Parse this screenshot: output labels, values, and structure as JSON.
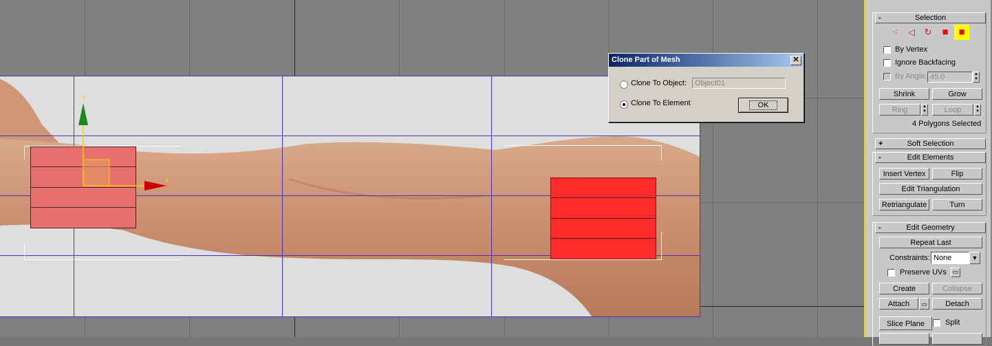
{
  "dialog": {
    "title": "Clone Part of Mesh",
    "close_glyph": "✕",
    "clone_to_object_label": "Clone To Object:",
    "clone_to_object_value": "Object01",
    "clone_to_element_label": "Clone To Element",
    "selected_option": "Clone To Element",
    "ok_label": "OK"
  },
  "gizmo": {
    "x_axis_label": "x",
    "y_axis_label": "y"
  },
  "panel": {
    "selection": {
      "header": "Selection",
      "header_sign": "-",
      "subobject_icons": [
        "vertex-icon",
        "edge-icon",
        "border-icon",
        "polygon-icon",
        "element-icon"
      ],
      "by_vertex_label": "By Vertex",
      "ignore_backfacing_label": "Ignore Backfacing",
      "by_angle_label": "By Angle:",
      "by_angle_value": "45.0",
      "shrink_label": "Shrink",
      "grow_label": "Grow",
      "ring_label": "Ring",
      "loop_label": "Loop",
      "status": "4 Polygons Selected"
    },
    "soft_selection": {
      "header": "Soft Selection",
      "header_sign": "+"
    },
    "edit_elements": {
      "header": "Edit Elements",
      "header_sign": "-",
      "insert_vertex_label": "Insert Vertex",
      "flip_label": "Flip",
      "edit_triangulation_label": "Edit Triangulation",
      "retriangulate_label": "Retriangulate",
      "turn_label": "Turn"
    },
    "edit_geometry": {
      "header": "Edit Geometry",
      "header_sign": "-",
      "repeat_last_label": "Repeat Last",
      "constraints_label": "Constraints:",
      "constraints_value": "None",
      "preserve_uvs_label": "Preserve UVs",
      "create_label": "Create",
      "collapse_label": "Collapse",
      "attach_label": "Attach",
      "detach_label": "Detach",
      "slice_plane_label": "Slice Plane",
      "split_label": "Split"
    }
  },
  "colors": {
    "viewport_bg": "#808080",
    "selected_element": "#ff2a2a",
    "selected_element_faded": "#e87070",
    "grid_lines": "#4c2fb7",
    "active_icon_bg": "#ffff00"
  }
}
